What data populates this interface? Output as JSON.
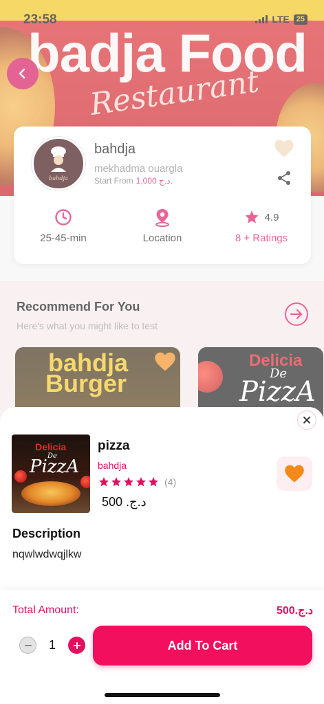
{
  "status_bar": {
    "time": "23:58",
    "network": "LTE",
    "battery": "25"
  },
  "banner": {
    "brand_title": "badja Food",
    "brand_script": "Restaurant"
  },
  "restaurant": {
    "name": "bahdja",
    "location": "mekhadma ouargla",
    "start_from_label": "Start From",
    "start_from_price": "1,000 د.ج.",
    "delivery_time": "25-45-min",
    "location_label": "Location",
    "rating": "4.9",
    "ratings_count_label": "8 + Ratings",
    "avatar_text": "bahdja"
  },
  "recommend": {
    "title": "Recommend For You",
    "subtitle": "Here's what you might like to test",
    "cards": [
      {
        "line1": "bahdja",
        "line2": "Burger"
      },
      {
        "line1": "Delicia",
        "line2": "De",
        "line3": "PizzA"
      }
    ]
  },
  "product": {
    "image_text": {
      "line1": "Delicia",
      "line2": "De",
      "line3": "PizzA"
    },
    "name": "pizza",
    "restaurant": "bahdja",
    "stars": 5,
    "review_count": "(4)",
    "price": "500 .د.ج",
    "description_title": "Description",
    "description": "nqwlwdwqjlkw"
  },
  "footer": {
    "total_label": "Total Amount:",
    "total_value": "500.د.ج",
    "quantity": "1",
    "add_to_cart": "Add To Cart"
  },
  "colors": {
    "accent": "#e0115f",
    "button": "#f20f5e",
    "favorite": "#f38a1a"
  }
}
